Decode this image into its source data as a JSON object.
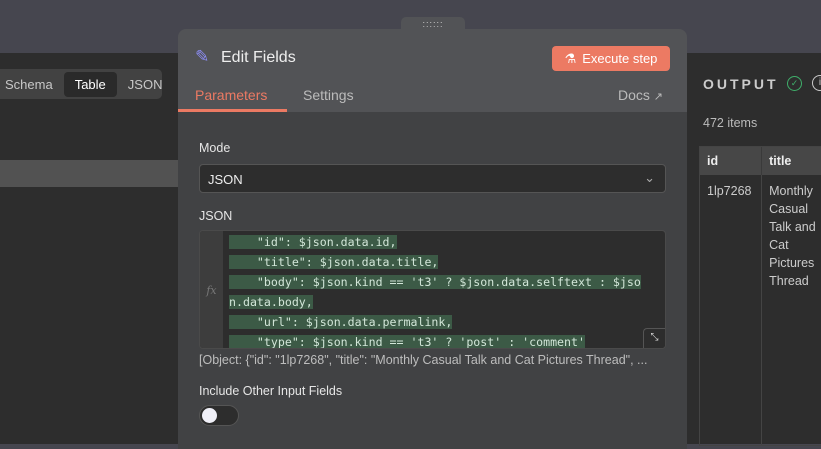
{
  "left": {
    "view_tabs": [
      "Schema",
      "Table",
      "JSON"
    ],
    "active": "Table"
  },
  "node": {
    "title": "Edit Fields",
    "execute_label": "Execute step",
    "tabs": [
      "Parameters",
      "Settings"
    ],
    "active_tab": "Parameters",
    "docs_label": "Docs",
    "grip": "::::::",
    "mode_label": "Mode",
    "mode_value": "JSON",
    "json_label": "JSON",
    "fx": "fx",
    "code_lines": [
      "    \"id\": $json.data.id,",
      "    \"title\": $json.data.title,",
      "    \"body\": $json.kind == 't3' ? $json.data.selftext : $jso",
      "n.data.body,",
      "    \"url\": $json.data.permalink,",
      "    \"type\": $json.kind == 't3' ? 'post' : 'comment'"
    ],
    "preview": "[Object: {\"id\": \"1lp7268\", \"title\": \"Monthly Casual Talk and Cat Pictures Thread\", ...",
    "include_label": "Include Other Input Fields",
    "include_value": false
  },
  "output": {
    "title": "OUTPUT",
    "count": "472 items",
    "columns": [
      "id",
      "title"
    ],
    "rows": [
      [
        "1lp7268",
        "Monthly Casual Talk and Cat Pictures Thread"
      ]
    ]
  },
  "colors": {
    "accent": "#ec7a63",
    "success": "#3fae6a",
    "node_icon": "#8b8cf2"
  }
}
